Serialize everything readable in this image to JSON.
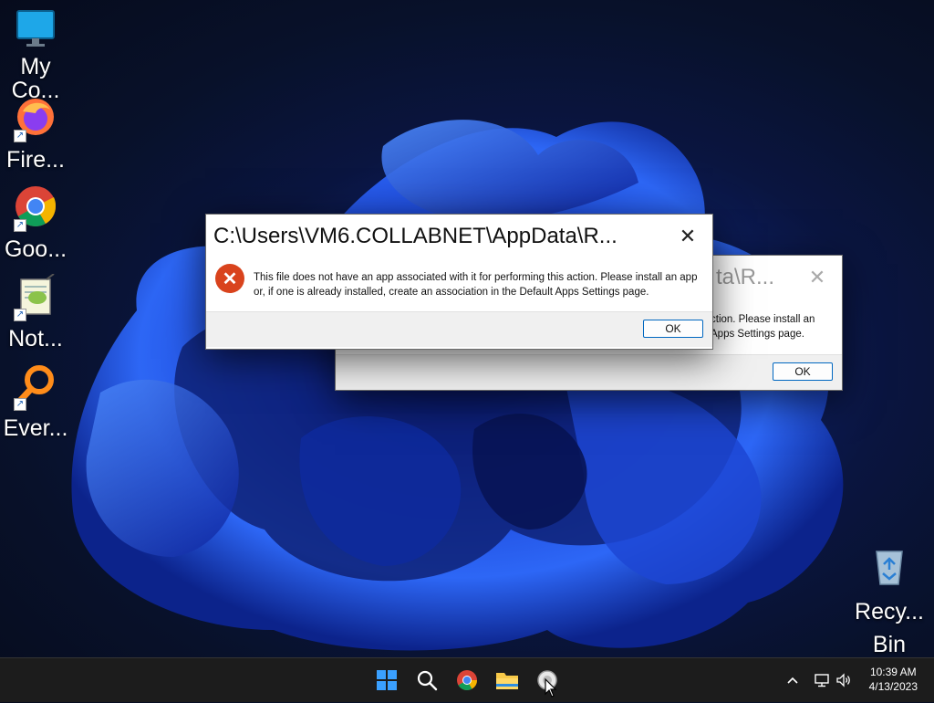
{
  "desktop": {
    "icons": [
      {
        "label": "My\nCo...",
        "icon": "computer-icon"
      },
      {
        "label": "Fire...",
        "icon": "firefox-icon"
      },
      {
        "label": "Goo...",
        "icon": "chrome-icon"
      },
      {
        "label": "Not...",
        "icon": "notepadpp-icon"
      },
      {
        "label": "Ever...",
        "icon": "everything-search-icon"
      }
    ],
    "recycle_bin": {
      "label_line1": "Recy...",
      "label_line2": "Bin",
      "icon": "recycle-bin-icon"
    }
  },
  "dialog_front": {
    "title": "C:\\Users\\VM6.COLLABNET\\AppData\\R...",
    "message": "This file does not have an app associated with it for performing this action. Please install an app or, if one is already installed, create an association in the Default Apps Settings page.",
    "ok_label": "OK",
    "close_glyph": "✕"
  },
  "dialog_back": {
    "title_visible": "ta\\R...",
    "message_line1": "ction. Please install an",
    "message_line2": "Apps Settings page.",
    "ok_label": "OK",
    "close_glyph": "✕"
  },
  "taskbar": {
    "buttons": [
      "start-icon",
      "search-icon",
      "chrome-icon",
      "file-explorer-icon",
      "app-icon"
    ],
    "tray_chevron": "^",
    "time": "10:39 AM",
    "date": "4/13/2023"
  },
  "colors": {
    "error_red": "#d9431d",
    "accent_blue": "#0067c0",
    "taskbar": "#1c1c1c"
  }
}
